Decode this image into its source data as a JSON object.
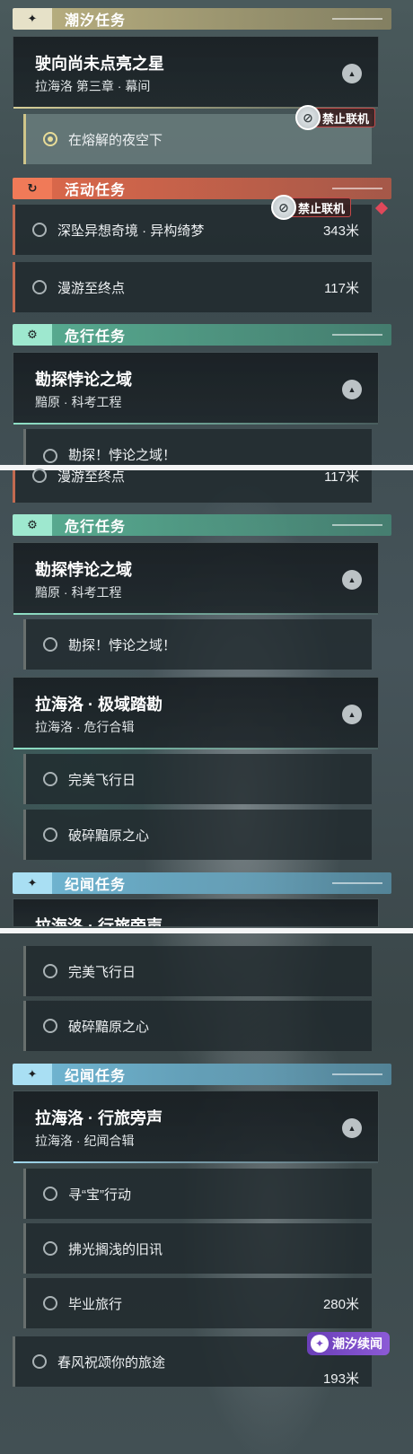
{
  "categories": {
    "tide": "潮汐任务",
    "event": "活动任务",
    "danger": "危行任务",
    "lore": "纪闻任务"
  },
  "icons": {
    "tide": "sparkle-icon",
    "event": "refresh-icon",
    "danger": "gear-icon",
    "lore": "sparkle-icon"
  },
  "quests": {
    "tide_main": {
      "title": "驶向尚未点亮之星",
      "sub": "拉海洛 第三章 · 幕间"
    },
    "tide_sub1": "在熔解的夜空下",
    "event1": {
      "name": "深坠异想奇境 · 异构绮梦",
      "dist": "343米"
    },
    "event2": {
      "name": "漫游至终点",
      "dist": "117米"
    },
    "danger_main": {
      "title": "勘探悖论之域",
      "sub": "黯原 · 科考工程"
    },
    "danger_sub": "勘探！悖论之域！",
    "danger_sub_cut": "勘探！悖论之域！",
    "event2_cut": {
      "name": "漫游至终点",
      "dist": "117米"
    },
    "danger_main2": {
      "title": "拉海洛 · 极域踏勘",
      "sub": "拉海洛 · 危行合辑"
    },
    "d2_sub1": "完美飞行日",
    "d2_sub2": "破碎黯原之心",
    "lore_cut_title": "拉海洛 · 行旅旁声",
    "lore_main": {
      "title": "拉海洛 · 行旅旁声",
      "sub": "拉海洛 · 纪闻合辑"
    },
    "lore_sub1": "寻“宝”行动",
    "lore_sub2": "拂光搁浅的旧讯",
    "lore_sub3": {
      "name": "毕业旅行",
      "dist": "280米"
    },
    "lore_sub4": {
      "name": "春风祝颂你的旅途",
      "dist": "193米"
    }
  },
  "badges": {
    "no_coop": "禁止联机",
    "tide_story": "潮汐续闻"
  },
  "colors": {
    "tide": "#e6e1c8",
    "event": "#f07a58",
    "danger": "#9ee8cf",
    "lore": "#a9dff3",
    "badge_red": "#c44a4a",
    "tide_tag": "#8c5ad6"
  }
}
